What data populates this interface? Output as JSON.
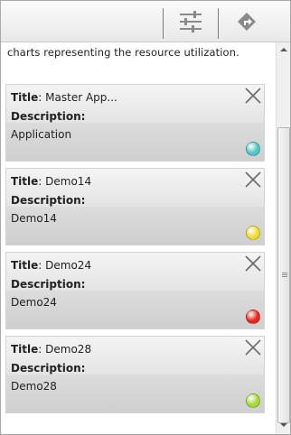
{
  "intro_text": "charts representing the resource utilization.",
  "labels": {
    "title": "Title",
    "description": "Description:"
  },
  "toolbar": {
    "filter_icon": "sliders-icon",
    "navigate_icon": "directions-sign-icon"
  },
  "cards": [
    {
      "title": "Master App...",
      "description": "Application",
      "status_color": "#4fc6c4"
    },
    {
      "title": "Demo14",
      "description": "Demo14",
      "status_color": "#f2dc2e"
    },
    {
      "title": "Demo24",
      "description": "Demo24",
      "status_color": "#e8261c"
    },
    {
      "title": "Demo28",
      "description": "Demo28",
      "status_color": "#a6d837"
    }
  ]
}
